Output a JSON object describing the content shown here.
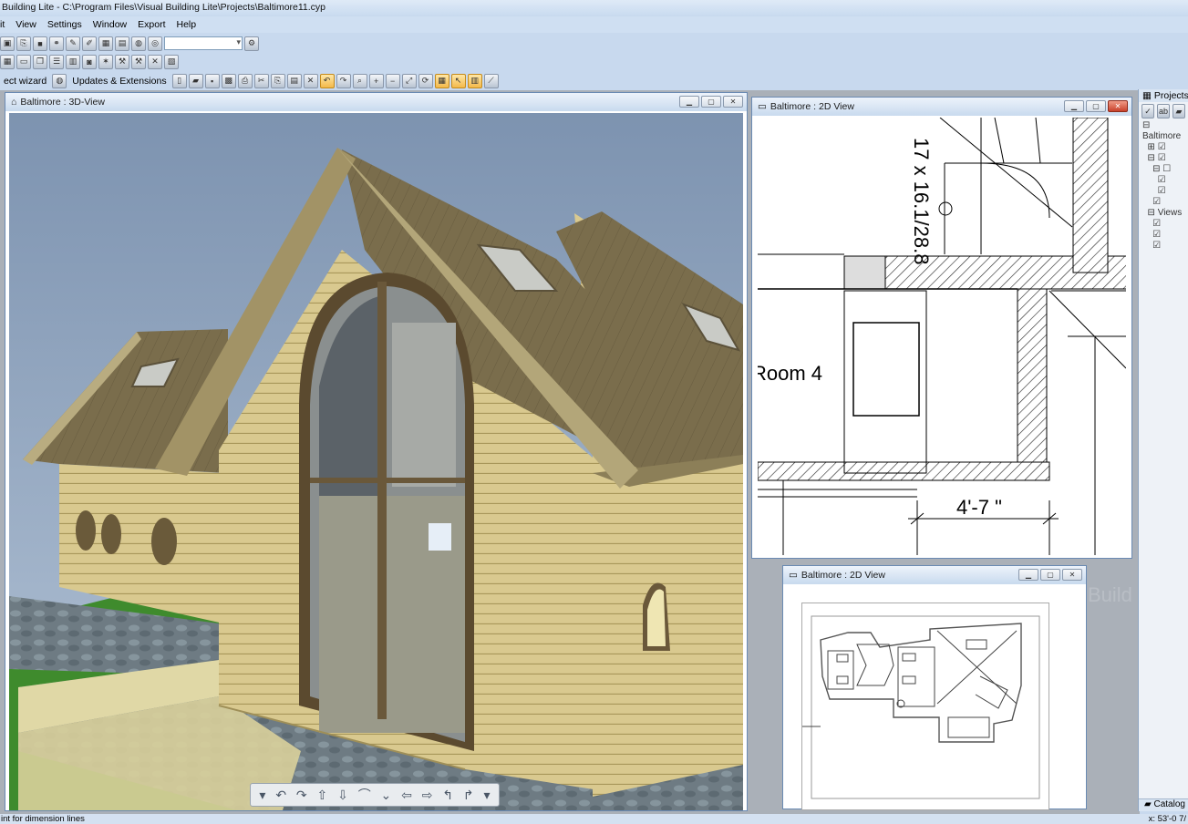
{
  "app": {
    "title": "Building Lite - C:\\Program Files\\Visual Building Lite\\Projects\\Baltimore11.cyp"
  },
  "menu": [
    "it",
    "View",
    "Settings",
    "Window",
    "Export",
    "Help"
  ],
  "toolbar": {
    "wizard_label": "ect wizard",
    "updates_label": "Updates & Extensions"
  },
  "windows": {
    "view3d": {
      "title": "Baltimore : 3D-View"
    },
    "view2d": {
      "title": "Baltimore : 2D View"
    },
    "view2d_small": {
      "title": "Baltimore : 2D View"
    }
  },
  "plan": {
    "stair_label": "17 x 16.1/28.8",
    "room_label": "Room 4",
    "dimension_label": "4'-7 \""
  },
  "projects": {
    "title": "Projects",
    "tree": [
      "Baltimore",
      "Views"
    ],
    "catalog_label": "Catalog"
  },
  "status": {
    "message": "int for dimension lines",
    "coords": "x: 53'-0 7/"
  },
  "watermark": "Build",
  "colors": {
    "accent": "#3a6ea5",
    "titlebar": "#c9dbf0",
    "close": "#c8412b"
  }
}
